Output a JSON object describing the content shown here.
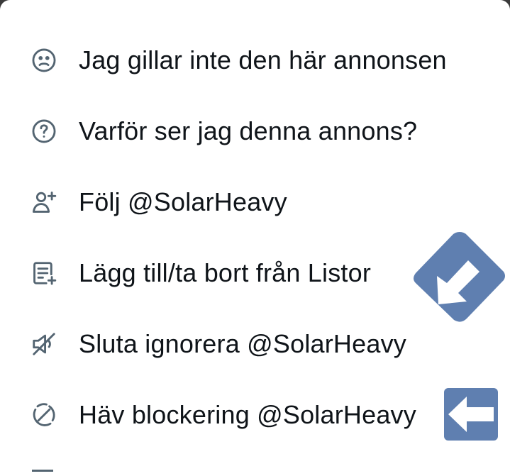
{
  "menu": {
    "items": [
      {
        "label": "Jag gillar inte den här annonsen",
        "icon": "frown-face-icon"
      },
      {
        "label": "Varför ser jag denna annons?",
        "icon": "question-circle-icon"
      },
      {
        "label": "Följ @SolarHeavy",
        "icon": "follow-user-icon"
      },
      {
        "label": "Lägg till/ta bort från Listor",
        "icon": "list-add-icon"
      },
      {
        "label": "Sluta ignorera @SolarHeavy",
        "icon": "unmute-speaker-icon"
      },
      {
        "label": "Häv blockering @SolarHeavy",
        "icon": "unblock-icon"
      }
    ]
  },
  "colors": {
    "text": "#0f1419",
    "icon": "#536471",
    "arrow_fill": "#5f7fb0",
    "arrow_glyph": "#ffffff"
  },
  "overlays": {
    "diagonal_arrow": "down-left-arrow-icon",
    "left_arrow": "left-arrow-icon"
  }
}
